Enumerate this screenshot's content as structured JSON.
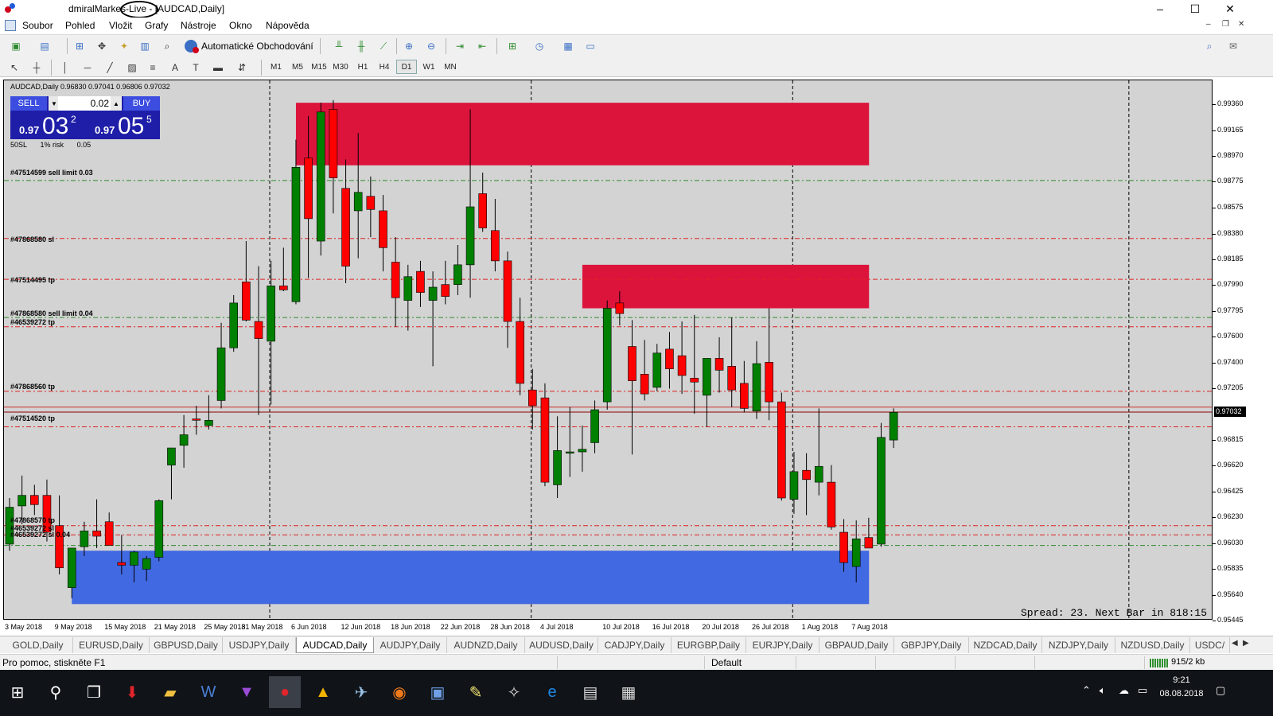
{
  "window": {
    "title_part1": "dmiralMarke",
    "title_part2": "s-Live",
    "title_part3": " - [AUDCAD,Daily]",
    "minimize": "–",
    "maximize": "☐",
    "close": "✕"
  },
  "menu": {
    "items": [
      "Soubor",
      "Pohled",
      "Vložit",
      "Grafy",
      "Nástroje",
      "Okno",
      "Nápověda"
    ]
  },
  "toolbar": {
    "auto_trading_label": "Automatické Obchodování",
    "timeframes": [
      "M1",
      "M5",
      "M15",
      "M30",
      "H1",
      "H4",
      "D1",
      "W1",
      "MN"
    ],
    "active_timeframe": "D1"
  },
  "chart": {
    "symbol_header": "AUDCAD,Daily  0.96830 0.97041 0.96806 0.97032",
    "one_click": {
      "sell_label": "SELL",
      "buy_label": "BUY",
      "lot": "0.02",
      "bid_prefix": "0.97",
      "bid_big": "03",
      "bid_sup": "2",
      "ask_prefix": "0.97",
      "ask_big": "05",
      "ask_sup": "5",
      "info": [
        "50SL",
        "1% risk",
        "0.05"
      ]
    },
    "line_labels": [
      "#47514599 sell limit 0.03",
      "#47868580 sl",
      "#47514495 tp",
      "#47868580 sell limit 0.04",
      "#46539272 tp",
      "#47868560 tp",
      "#47514520 tp",
      "#47868570 tp",
      "#46539272 sl",
      "#46539272 sl 0.04"
    ],
    "y_ticks": [
      "0.99360",
      "0.99165",
      "0.98970",
      "0.98775",
      "0.98575",
      "0.98380",
      "0.98185",
      "0.97990",
      "0.97795",
      "0.97600",
      "0.97400",
      "0.97205",
      "0.96815",
      "0.96620",
      "0.96425",
      "0.96230",
      "0.96030",
      "0.95835",
      "0.95640",
      "0.95445"
    ],
    "current_price": "0.97032",
    "x_ticks": [
      "3 May 2018",
      "9 May 2018",
      "15 May 2018",
      "21 May 2018",
      "25 May 2018",
      "31 May 2018",
      "6 Jun 2018",
      "12 Jun 2018",
      "18 Jun 2018",
      "22 Jun 2018",
      "28 Jun 2018",
      "4 Jul 2018",
      "10 Jul 2018",
      "16 Jul 2018",
      "20 Jul 2018",
      "26 Jul 2018",
      "1 Aug 2018",
      "7 Aug 2018"
    ],
    "spread_text": "Spread: 23. Next Bar in 818:15",
    "colors": {
      "bull": "#008000",
      "bear": "#ff0000",
      "supply_zone": "#dc143c",
      "demand_zone": "#4169e1",
      "background": "#d3d3d3"
    }
  },
  "chart_data": {
    "type": "candlestick",
    "symbol": "AUDCAD",
    "timeframe": "Daily",
    "ylim": [
      0.9545,
      0.9955
    ],
    "candles": [
      [
        0.9603,
        0.9638,
        0.9598,
        0.9631
      ],
      [
        0.9632,
        0.9655,
        0.9618,
        0.964
      ],
      [
        0.964,
        0.9648,
        0.9625,
        0.9633
      ],
      [
        0.964,
        0.9652,
        0.9605,
        0.9612
      ],
      [
        0.9617,
        0.964,
        0.958,
        0.9585
      ],
      [
        0.957,
        0.959,
        0.9562,
        0.96
      ],
      [
        0.9601,
        0.962,
        0.9594,
        0.9613
      ],
      [
        0.9613,
        0.9637,
        0.96,
        0.9609
      ],
      [
        0.962,
        0.9627,
        0.9604,
        0.9602
      ],
      [
        0.9589,
        0.961,
        0.958,
        0.9587
      ],
      [
        0.9587,
        0.9598,
        0.9574,
        0.9597
      ],
      [
        0.9584,
        0.9594,
        0.9575,
        0.9592
      ],
      [
        0.9593,
        0.9637,
        0.959,
        0.9636
      ],
      [
        0.9663,
        0.9672,
        0.9637,
        0.9676
      ],
      [
        0.9678,
        0.9701,
        0.9661,
        0.9686
      ],
      [
        0.9698,
        0.9708,
        0.9686,
        0.9697
      ],
      [
        0.9693,
        0.9716,
        0.969,
        0.9697
      ],
      [
        0.9712,
        0.9771,
        0.9706,
        0.9752
      ],
      [
        0.9752,
        0.9792,
        0.9749,
        0.9786
      ],
      [
        0.9802,
        0.9833,
        0.9772,
        0.9773
      ],
      [
        0.9772,
        0.9814,
        0.9701,
        0.9759
      ],
      [
        0.9757,
        0.9818,
        0.9709,
        0.9799
      ],
      [
        0.9799,
        0.9828,
        0.9795,
        0.9796
      ],
      [
        0.9787,
        0.991,
        0.9785,
        0.9889
      ],
      [
        0.9896,
        0.9928,
        0.9805,
        0.985
      ],
      [
        0.9833,
        0.9938,
        0.9822,
        0.9931
      ],
      [
        0.9933,
        0.994,
        0.9854,
        0.9881
      ],
      [
        0.9873,
        0.9895,
        0.9801,
        0.9814
      ],
      [
        0.9856,
        0.9915,
        0.982,
        0.987
      ],
      [
        0.9867,
        0.9882,
        0.9836,
        0.9857
      ],
      [
        0.9856,
        0.9868,
        0.981,
        0.9828
      ],
      [
        0.9817,
        0.9836,
        0.9768,
        0.979
      ],
      [
        0.9788,
        0.9815,
        0.9765,
        0.9806
      ],
      [
        0.981,
        0.9818,
        0.9783,
        0.9794
      ],
      [
        0.9788,
        0.981,
        0.9738,
        0.9798
      ],
      [
        0.98,
        0.9818,
        0.9785,
        0.9791
      ],
      [
        0.98,
        0.983,
        0.9792,
        0.9815
      ],
      [
        0.9815,
        0.9933,
        0.979,
        0.9859
      ],
      [
        0.9869,
        0.9885,
        0.984,
        0.9843
      ],
      [
        0.9841,
        0.9865,
        0.981,
        0.9818
      ],
      [
        0.9818,
        0.9825,
        0.9752,
        0.9772
      ],
      [
        0.9772,
        0.979,
        0.9716,
        0.9725
      ],
      [
        0.972,
        0.9736,
        0.969,
        0.9708
      ],
      [
        0.9714,
        0.9725,
        0.9647,
        0.965
      ],
      [
        0.9648,
        0.97,
        0.9638,
        0.9674
      ],
      [
        0.9672,
        0.9707,
        0.9654,
        0.9673
      ],
      [
        0.9673,
        0.9693,
        0.9658,
        0.9675
      ],
      [
        0.968,
        0.9712,
        0.9672,
        0.9705
      ],
      [
        0.9711,
        0.9788,
        0.9705,
        0.9782
      ],
      [
        0.9786,
        0.9795,
        0.9769,
        0.9778
      ],
      [
        0.9753,
        0.9773,
        0.9671,
        0.9727
      ],
      [
        0.9732,
        0.9758,
        0.9712,
        0.9717
      ],
      [
        0.9722,
        0.9755,
        0.9719,
        0.9748
      ],
      [
        0.9751,
        0.9764,
        0.9721,
        0.9736
      ],
      [
        0.9746,
        0.9772,
        0.9717,
        0.9731
      ],
      [
        0.9729,
        0.9777,
        0.9702,
        0.9726
      ],
      [
        0.9716,
        0.9736,
        0.9692,
        0.9744
      ],
      [
        0.9744,
        0.976,
        0.9718,
        0.9735
      ],
      [
        0.9738,
        0.9775,
        0.9707,
        0.972
      ],
      [
        0.9725,
        0.9742,
        0.9703,
        0.9706
      ],
      [
        0.9704,
        0.9757,
        0.9698,
        0.974
      ],
      [
        0.9741,
        0.9782,
        0.9697,
        0.9711
      ],
      [
        0.9711,
        0.9718,
        0.9636,
        0.9638
      ],
      [
        0.9637,
        0.9673,
        0.9626,
        0.9658
      ],
      [
        0.9659,
        0.9672,
        0.9625,
        0.9652
      ],
      [
        0.965,
        0.9706,
        0.964,
        0.9662
      ],
      [
        0.965,
        0.9663,
        0.9614,
        0.9616
      ],
      [
        0.9612,
        0.9622,
        0.9582,
        0.9589
      ],
      [
        0.9586,
        0.9621,
        0.9574,
        0.9607
      ],
      [
        0.9608,
        0.9623,
        0.9601,
        0.96
      ],
      [
        0.9603,
        0.9695,
        0.9601,
        0.9684
      ],
      [
        0.9682,
        0.9706,
        0.9676,
        0.9703
      ]
    ],
    "horizontal_lines": [
      {
        "price": 0.9879,
        "style": "dash",
        "color": "#2e8b2e"
      },
      {
        "price": 0.9835,
        "style": "dash",
        "color": "#dd2222"
      },
      {
        "price": 0.9804,
        "style": "dash",
        "color": "#dd2222"
      },
      {
        "price": 0.9775,
        "style": "dash",
        "color": "#2e8b2e"
      },
      {
        "price": 0.9768,
        "style": "dash",
        "color": "#dd2222"
      },
      {
        "price": 0.9719,
        "style": "dash",
        "color": "#dd2222"
      },
      {
        "price": 0.9707,
        "style": "solid",
        "color": "#cc3333"
      },
      {
        "price": 0.97032,
        "style": "solid",
        "color": "#8b0000"
      },
      {
        "price": 0.9692,
        "style": "dash",
        "color": "#dd2222"
      },
      {
        "price": 0.9617,
        "style": "dash",
        "color": "#dd2222"
      },
      {
        "price": 0.961,
        "style": "dash",
        "color": "#dd2222"
      },
      {
        "price": 0.9602,
        "style": "dash",
        "color": "#2e8b2e"
      }
    ],
    "zones": [
      {
        "kind": "supply",
        "start_index": 23,
        "end_index": 65,
        "top": 0.9938,
        "bottom": 0.98905
      },
      {
        "kind": "supply",
        "start_index": 46,
        "end_index": 65,
        "top": 0.9815,
        "bottom": 0.9782
      },
      {
        "kind": "demand",
        "start_index": 5,
        "end_index": 65,
        "top": 0.9598,
        "bottom": 0.95575
      }
    ],
    "vertical_separators": [
      20,
      41,
      62,
      89
    ]
  },
  "symbol_tabs": [
    "GOLD,Daily",
    "EURUSD,Daily",
    "GBPUSD,Daily",
    "USDJPY,Daily",
    "AUDCAD,Daily",
    "AUDJPY,Daily",
    "AUDNZD,Daily",
    "AUDUSD,Daily",
    "CADJPY,Daily",
    "EURGBP,Daily",
    "EURJPY,Daily",
    "GBPAUD,Daily",
    "GBPJPY,Daily",
    "NZDCAD,Daily",
    "NZDJPY,Daily",
    "NZDUSD,Daily",
    "USDC/"
  ],
  "active_tab": "AUDCAD,Daily",
  "status": {
    "help": "Pro pomoc, stiskněte F1",
    "profile": "Default",
    "traffic": "915/2 kb"
  },
  "taskbar": {
    "time": "9:21",
    "date": "08.08.2018"
  }
}
